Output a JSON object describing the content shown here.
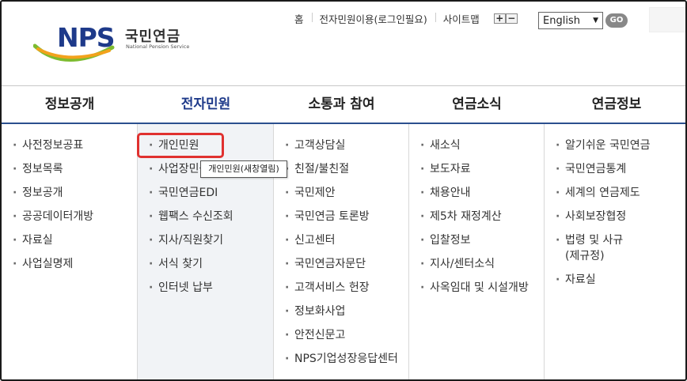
{
  "header": {
    "logo": {
      "brand": "NPS",
      "name_ko": "국민연금",
      "name_en": "National Pension Service"
    },
    "util_links": [
      "홈",
      "전자민원이용(로그인필요)",
      "사이트맵"
    ],
    "zoom": {
      "in_label": "+",
      "out_label": "−"
    },
    "language": {
      "selected": "English"
    },
    "go_label": "GO"
  },
  "gnb": [
    "정보공개",
    "전자민원",
    "소통과 참여",
    "연금소식",
    "연금정보"
  ],
  "menu": {
    "col1": [
      "사전정보공표",
      "정보목록",
      "정보공개",
      "공공데이터개방",
      "자료실",
      "사업실명제"
    ],
    "col2": [
      "개인민원",
      "사업장민원",
      "국민연금EDI",
      "웹팩스 수신조회",
      "지사/직원찾기",
      "서식 찾기",
      "인터넷 납부"
    ],
    "col3": [
      "고객상담실",
      "친절/불친절",
      "국민제안",
      "국민연금 토론방",
      "신고센터",
      "국민연금자문단",
      "고객서비스 헌장",
      "정보화사업",
      "안전신문고",
      "NPS기업성장응답센터"
    ],
    "col4": [
      "새소식",
      "보도자료",
      "채용안내",
      "제5차 재정계산",
      "입찰정보",
      "지사/센터소식",
      "사옥임대 및 시설개방"
    ],
    "col5": [
      "알기쉬운 국민연금",
      "국민연금통계",
      "세계의 연금제도",
      "사회보장협정",
      "법령 및 사규(제규정)",
      "자료실"
    ]
  },
  "tooltip": "개인민원(새창열림)",
  "colors": {
    "accent": "#1e3a8a",
    "highlight": "#e0312f"
  }
}
